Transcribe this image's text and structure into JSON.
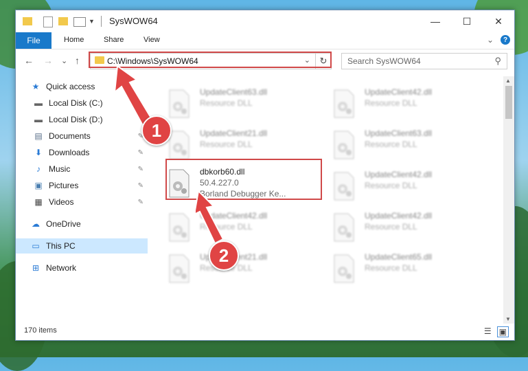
{
  "window": {
    "title": "SysWOW64",
    "minimize_glyph": "—",
    "maximize_glyph": "☐",
    "close_glyph": "✕"
  },
  "ribbon": {
    "tabs": [
      "File",
      "Home",
      "Share",
      "View"
    ],
    "collapse_glyph": "⌄",
    "help_glyph": "?"
  },
  "navigation": {
    "back_glyph": "←",
    "forward_glyph": "→",
    "recent_glyph": "⌄",
    "up_glyph": "↑",
    "address_path": "C:\\Windows\\SysWOW64",
    "address_chevron": "⌄",
    "refresh_glyph": "↻",
    "search_placeholder": "Search SysWOW64",
    "search_icon_glyph": "⚲"
  },
  "sidebar": {
    "items": [
      {
        "label": "Quick access",
        "icon": "star-icon",
        "glyph": "★",
        "color": "#2a7bd5",
        "pinned": false
      },
      {
        "label": "Local Disk (C:)",
        "icon": "drive-icon",
        "glyph": "▬",
        "color": "#666666",
        "pinned": true
      },
      {
        "label": "Local Disk (D:)",
        "icon": "drive-icon",
        "glyph": "▬",
        "color": "#666666",
        "pinned": true
      },
      {
        "label": "Documents",
        "icon": "documents-icon",
        "glyph": "▤",
        "color": "#5a6f8a",
        "pinned": true
      },
      {
        "label": "Downloads",
        "icon": "download-icon",
        "glyph": "⬇",
        "color": "#2a7bd5",
        "pinned": true
      },
      {
        "label": "Music",
        "icon": "music-icon",
        "glyph": "♪",
        "color": "#2a7bd5",
        "pinned": true
      },
      {
        "label": "Pictures",
        "icon": "pictures-icon",
        "glyph": "▣",
        "color": "#4b7fb0",
        "pinned": true
      },
      {
        "label": "Videos",
        "icon": "videos-icon",
        "glyph": "▦",
        "color": "#444444",
        "pinned": true
      },
      {
        "label": "OneDrive",
        "icon": "cloud-icon",
        "glyph": "☁",
        "color": "#2a7bd5",
        "pinned": false
      },
      {
        "label": "This PC",
        "icon": "computer-icon",
        "glyph": "▭",
        "color": "#2a7bd5",
        "pinned": false,
        "selected": true
      },
      {
        "label": "Network",
        "icon": "network-icon",
        "glyph": "⊞",
        "color": "#2a7bd5",
        "pinned": false
      }
    ],
    "pin_glyph": "✎"
  },
  "files": {
    "selected": {
      "name": "dbkorb60.dll",
      "version": "50.4.227.0",
      "description": "Borland Debugger Ke..."
    },
    "background": [
      {
        "name": "UpdateClient63.dll",
        "type": "Resource DLL"
      },
      {
        "name": "UpdateClient42.dll",
        "type": "Resource DLL"
      },
      {
        "name": "UpdateClient21.dll",
        "type": "Resource DLL"
      },
      {
        "name": "UpdateClient63.dll",
        "type": "Resource DLL"
      },
      {
        "name": "UpdateClient42.dll",
        "type": "Resource DLL"
      },
      {
        "name": "UpdateClient42.dll",
        "type": "Resource DLL"
      },
      {
        "name": "UpdateClient42.dll",
        "type": "Resource DLL"
      },
      {
        "name": "UpdateClient21.dll",
        "type": "Resource DLL"
      },
      {
        "name": "UpdateClient65.dll",
        "type": "Resource DLL"
      }
    ]
  },
  "status": {
    "item_count": "170 items"
  },
  "annotations": {
    "step1": "1",
    "step2": "2",
    "highlight_color": "#d04848"
  }
}
